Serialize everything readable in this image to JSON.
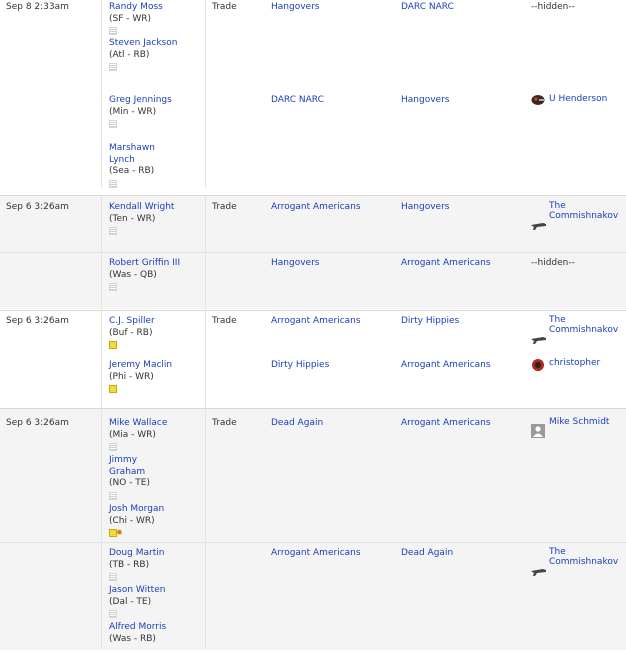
{
  "trades": [
    {
      "date": "Sep 8 2:33am",
      "type": "Trade",
      "legs": [
        {
          "players": [
            {
              "name": "Randy Moss",
              "pos": "(SF - WR)",
              "note": "blank"
            },
            {
              "name": "Steven Jackson",
              "pos": "(Atl - RB)",
              "note": "blank"
            }
          ],
          "from": "Hangovers",
          "to": "DARC NARC",
          "manager": "--hidden--",
          "avatar": ""
        },
        {
          "players": [
            {
              "name": "Greg Jennings",
              "pos": "(Min - WR)",
              "note": "blank"
            },
            {
              "name": "Marshawn Lynch",
              "pos": "(Sea - RB)",
              "note": "blank"
            }
          ],
          "from": "DARC NARC",
          "to": "Hangovers",
          "manager": "U Henderson",
          "avatar": "helmet-avatar-icon"
        }
      ]
    },
    {
      "date": "Sep 6 3:26am",
      "type": "Trade",
      "legs": [
        {
          "players": [
            {
              "name": "Kendall Wright",
              "pos": "(Ten - WR)",
              "note": "blank"
            }
          ],
          "from": "Arrogant Americans",
          "to": "Hangovers",
          "manager": "The Commishnakov",
          "avatar": "gun-avatar-icon"
        },
        {
          "players": [
            {
              "name": "Robert Griffin III",
              "pos": "(Was - QB)",
              "note": "blank"
            }
          ],
          "from": "Hangovers",
          "to": "Arrogant Americans",
          "manager": "--hidden--",
          "avatar": ""
        }
      ]
    },
    {
      "date": "Sep 6 3:26am",
      "type": "Trade",
      "legs": [
        {
          "players": [
            {
              "name": "C.J. Spiller",
              "pos": "(Buf - RB)",
              "note": "filled"
            }
          ],
          "from": "Arrogant Americans",
          "to": "Dirty Hippies",
          "manager": "The Commishnakov",
          "avatar": "gun-avatar-icon"
        },
        {
          "players": [
            {
              "name": "Jeremy Maclin",
              "pos": "(Phi - WR)",
              "note": "filled"
            }
          ],
          "from": "Dirty Hippies",
          "to": "Arrogant Americans",
          "manager": "christopher",
          "avatar": "team-logo-avatar-icon"
        }
      ]
    },
    {
      "date": "Sep 6 3:26am",
      "type": "Trade",
      "legs": [
        {
          "players": [
            {
              "name": "Mike Wallace",
              "pos": "(Mia - WR)",
              "note": "blank"
            },
            {
              "name": "Jimmy Graham",
              "pos": "(NO - TE)",
              "note": "blank"
            },
            {
              "name": "Josh Morgan",
              "pos": "(Chi - WR)",
              "note": "star"
            }
          ],
          "from": "Dead Again",
          "to": "Arrogant Americans",
          "manager": "Mike Schmidt",
          "avatar": "default-user-avatar-icon"
        },
        {
          "players": [
            {
              "name": "Doug Martin",
              "pos": "(TB - RB)",
              "note": "blank"
            },
            {
              "name": "Jason Witten",
              "pos": "(Dal - TE)",
              "note": "blank"
            },
            {
              "name": "Alfred Morris",
              "pos": "(Was - RB)",
              "note": "blank"
            }
          ],
          "from": "Arrogant Americans",
          "to": "Dead Again",
          "manager": "The Commishnakov",
          "avatar": "gun-avatar-icon"
        }
      ]
    }
  ]
}
